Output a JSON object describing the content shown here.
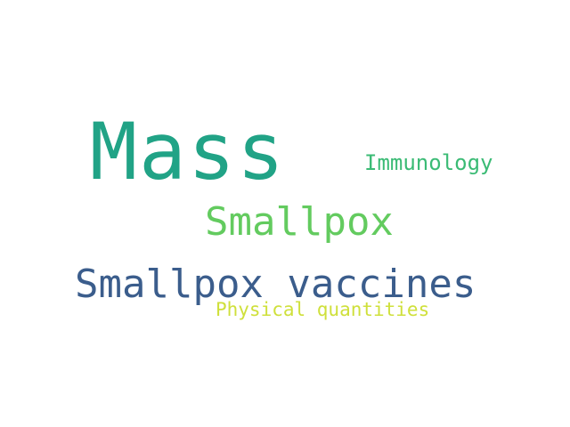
{
  "words": [
    {
      "text": "Mass",
      "color": "#21a386"
    },
    {
      "text": "Immunology",
      "color": "#3bbb75"
    },
    {
      "text": "Smallpox",
      "color": "#63cb5f"
    },
    {
      "text": "Smallpox vaccines",
      "color": "#3b5d8c"
    },
    {
      "text": "Physical quantities",
      "color": "#cfe03b"
    }
  ]
}
